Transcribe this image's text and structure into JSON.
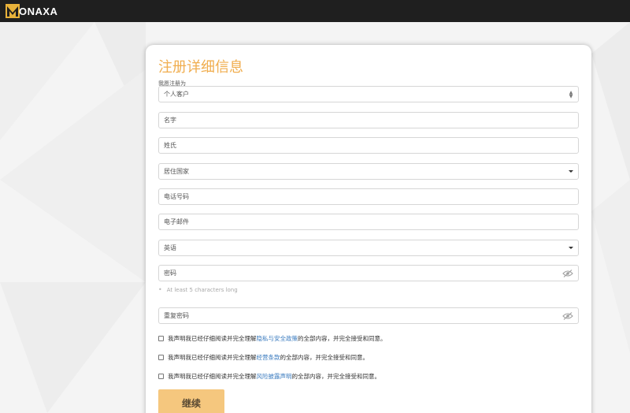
{
  "brand": {
    "logo_text": "ONAXA",
    "accent": "#f0ad4e"
  },
  "form": {
    "title": "注册详细信息",
    "register_as_label": "我愿注册为",
    "account_type": {
      "value": "个人客户"
    },
    "first_name": {
      "placeholder": "名字"
    },
    "last_name": {
      "placeholder": "姓氏"
    },
    "country": {
      "value": "居住国家"
    },
    "phone": {
      "placeholder": "电话号码"
    },
    "email": {
      "placeholder": "电子邮件"
    },
    "language": {
      "value": "英语"
    },
    "password": {
      "placeholder": "密码"
    },
    "password_hint": "At least 5 characters long",
    "repeat_password": {
      "placeholder": "重复密码"
    },
    "agreements": [
      {
        "prefix": "我声明我已经仔细阅读并完全理解",
        "link": "隐私与安全政策",
        "suffix": "的全部内容，并完全接受和同意。"
      },
      {
        "prefix": "我声明我已经仔细阅读并完全理解",
        "link": "经营条款",
        "suffix": "的全部内容，并完全接受和同意。"
      },
      {
        "prefix": "我声明我已经仔细阅读并完全理解",
        "link": "风险披露声明",
        "suffix": "的全部内容，并完全接受和同意。"
      }
    ],
    "submit_label": "继续"
  }
}
